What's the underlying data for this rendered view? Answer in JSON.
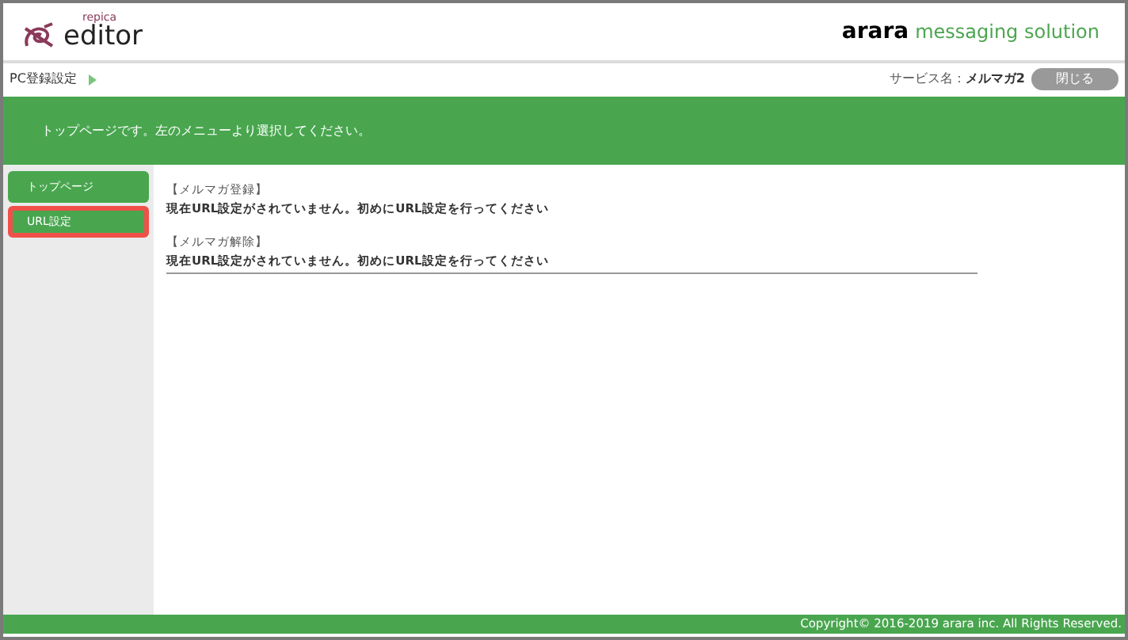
{
  "header": {
    "logo_small": "repica",
    "logo_large": "editor",
    "brand_bold": "arara",
    "brand_tail": "messaging solution"
  },
  "breadcrumb": {
    "label": "PC登録設定",
    "service_label": "サービス名：",
    "service_name": "メルマガ2",
    "close_button": "閉じる"
  },
  "banner": "トップページです。左のメニューより選択してください。",
  "sidebar": {
    "items": [
      {
        "label": "トップページ",
        "highlighted": false
      },
      {
        "label": "URL設定",
        "highlighted": true
      }
    ]
  },
  "sections": [
    {
      "heading": "【メルマガ登録】",
      "message": "現在URL設定がされていません。初めにURL設定を行ってください"
    },
    {
      "heading": "【メルマガ解除】",
      "message": "現在URL設定がされていません。初めにURL設定を行ってください"
    }
  ],
  "footer": "Copyright© 2016-2019 arara inc. All Rights Reserved."
}
